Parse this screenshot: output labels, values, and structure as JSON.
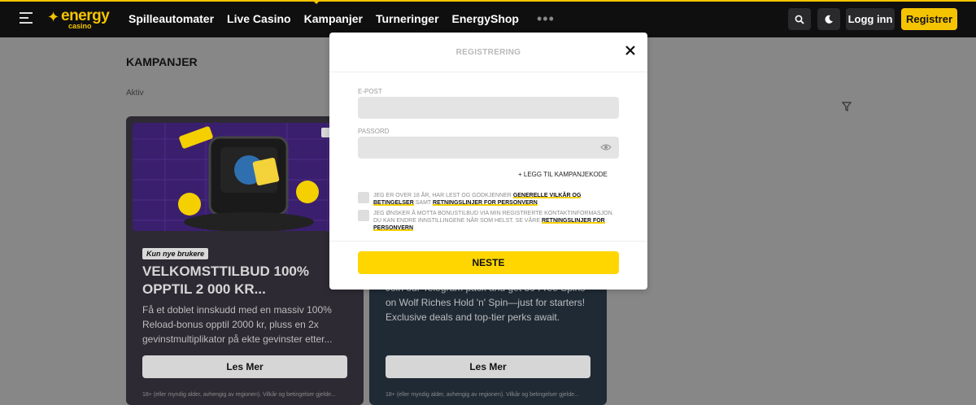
{
  "header": {
    "logo_main": "energy",
    "logo_sub": "casino",
    "nav": [
      {
        "label": "Spilleautomater"
      },
      {
        "label": "Live Casino"
      },
      {
        "label": "Kampanjer"
      },
      {
        "label": "Turneringer"
      },
      {
        "label": "EnergyShop"
      }
    ],
    "more_label": "•••",
    "login_label": "Logg inn",
    "register_label": "Registrer",
    "colors": {
      "accent": "#f5c400",
      "bar": "#0f0f10"
    }
  },
  "page": {
    "title": "KAMPANJER",
    "filter_label": "Aktiv"
  },
  "cards": [
    {
      "badge": "Kun nye brukere",
      "title": "VELKOMSTTILBUD 100% OPPTIL 2 000 KR...",
      "description": "Få et doblet innskudd med en massiv 100% Reload-bonus opptil 2000 kr, pluss en 2x gevinstmultiplikator på ekte gevinster etter...",
      "button": "Les Mer",
      "footnote": "18+ (eller myndig alder, avhengig av regionen). Vilkår og betingelser gjelde..."
    },
    {
      "description": "Join our Telegram pack and get 30 Free Spins on Wolf Riches Hold 'n' Spin—just for starters! Exclusive deals and top-tier perks await.",
      "button": "Les Mer",
      "footnote": "18+ (eller myndig alder, avhengig av regionen). Vilkår og betingelser gjelde..."
    }
  ],
  "modal": {
    "title": "REGISTRERING",
    "email_label": "E-POST",
    "email_value": "",
    "password_label": "PASSORD",
    "password_value": "",
    "promo_link": "+  LEGG TIL KAMPANJEKODE",
    "consent1_text": "JEG ER OVER 18 ÅR, HAR LEST OG GODKJENNER",
    "consent1_link1": "GENERELLE VILKÅR OG BETINGELSER",
    "consent1_mid": "SAMT",
    "consent1_link2": "RETNINGSLINJER FOR PERSONVERN",
    "consent2_text": "JEG ØNSKER Å MOTTA BONUSTILBUD VIA MIN REGISTRERTE KONTAKTINFORMASJON. DU KAN ENDRE INNSTILLINGENE NÅR SOM HELST. SE VÅRE",
    "consent2_link": "RETNINGSLINJER FOR PERSONVERN",
    "next_label": "NESTE",
    "colors": {
      "button": "#ffd600",
      "field": "#e4e4e4"
    }
  }
}
